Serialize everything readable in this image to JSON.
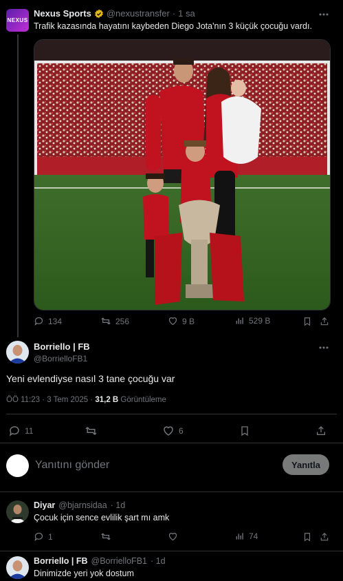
{
  "quoted": {
    "name": "Nexus Sports",
    "handle": "@nexustransfer",
    "time": "1 sa",
    "text": "Trafik kazasında hayatını kaybeden Diego Jota'nın 3 küçük çocuğu vardı.",
    "avatar_text": "NEXUS",
    "stats": {
      "replies": "134",
      "reposts": "256",
      "likes": "9 B",
      "views": "529 B"
    }
  },
  "post": {
    "name": "Borriello | FB",
    "handle": "@BorrielloFB1",
    "text": "Yeni evlendiyse nasıl 3 tane çocuğu var",
    "time": "ÖÖ 11:23 · 3 Tem 2025 · ",
    "views_count": "31,2 B",
    "views_label": " Görüntüleme",
    "stats": {
      "replies": "11",
      "likes": "6"
    }
  },
  "compose": {
    "placeholder": "Yanıtını gönder",
    "button": "Yanıtla"
  },
  "replies": [
    {
      "name": "Diyar",
      "handle": "@bjarnsidaa",
      "time": "· 1d",
      "text": "Çocuk için sence evlilik şart mı amk",
      "stats": {
        "replies": "1",
        "views": "74"
      }
    },
    {
      "name": "Borriello | FB",
      "handle": "@BorrielloFB1",
      "time": "· 1d",
      "text": "Dinimizde yeri yok dostum"
    }
  ],
  "colors": {
    "background": "#000000",
    "text": "#e7e9ea",
    "muted": "#71767b",
    "verified": "#e2b719",
    "divider": "#2f3336"
  }
}
